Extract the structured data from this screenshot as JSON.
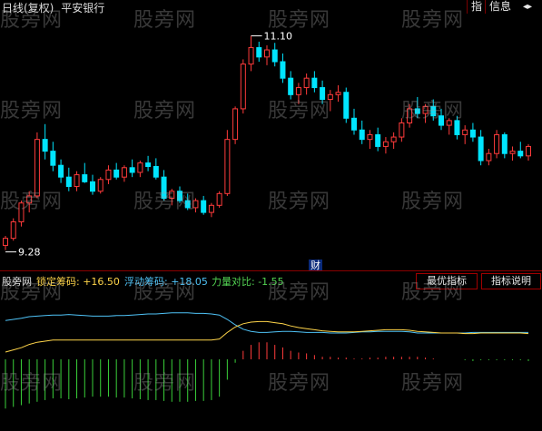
{
  "header": {
    "title": "日线(复权)",
    "stock": "平安银行",
    "btn_zhi": "指",
    "btn_info": "信息",
    "btn_close": "◂▸"
  },
  "watermark": "股旁网",
  "main_chart": {
    "high_label": "11.10",
    "low_label": "9.28",
    "cai_label": "财"
  },
  "sub_header": {
    "name": "股旁网",
    "lock": "锁定筹码: +16.50",
    "float": "浮动筹码: +18.05",
    "ratio": "力量对比: -1.55"
  },
  "tabs": {
    "best": "最优指标",
    "explain": "指标说明"
  },
  "colors": {
    "up": "#ff3b3b",
    "down": "#00e5ff",
    "lock_line": "#ffd54a",
    "float_line": "#4fc3f7",
    "pos_bar": "#ff3b3b",
    "neg_bar": "#3ad13a",
    "divider": "#8b0000"
  },
  "chart_data": {
    "type": "candlestick",
    "ohlc": [
      [
        9.32,
        9.4,
        9.28,
        9.38
      ],
      [
        9.38,
        9.55,
        9.36,
        9.52
      ],
      [
        9.52,
        9.7,
        9.48,
        9.68
      ],
      [
        9.68,
        9.78,
        9.6,
        9.74
      ],
      [
        9.74,
        10.28,
        9.72,
        10.22
      ],
      [
        10.22,
        10.35,
        10.05,
        10.12
      ],
      [
        10.12,
        10.2,
        9.95,
        10.0
      ],
      [
        10.0,
        10.05,
        9.85,
        9.9
      ],
      [
        9.9,
        9.98,
        9.78,
        9.82
      ],
      [
        9.82,
        9.95,
        9.78,
        9.92
      ],
      [
        9.92,
        10.02,
        9.85,
        9.86
      ],
      [
        9.86,
        9.92,
        9.75,
        9.78
      ],
      [
        9.78,
        9.9,
        9.76,
        9.88
      ],
      [
        9.88,
        10.0,
        9.84,
        9.96
      ],
      [
        9.96,
        10.02,
        9.88,
        9.9
      ],
      [
        9.9,
        10.0,
        9.86,
        9.98
      ],
      [
        9.98,
        10.05,
        9.9,
        9.94
      ],
      [
        9.94,
        10.04,
        9.9,
        10.02
      ],
      [
        10.02,
        10.08,
        9.95,
        9.99
      ],
      [
        9.99,
        10.06,
        9.88,
        9.9
      ],
      [
        9.9,
        9.96,
        9.7,
        9.72
      ],
      [
        9.72,
        9.8,
        9.66,
        9.78
      ],
      [
        9.78,
        9.82,
        9.68,
        9.7
      ],
      [
        9.7,
        9.76,
        9.62,
        9.64
      ],
      [
        9.64,
        9.72,
        9.6,
        9.7
      ],
      [
        9.7,
        9.74,
        9.58,
        9.6
      ],
      [
        9.6,
        9.68,
        9.56,
        9.66
      ],
      [
        9.66,
        9.78,
        9.64,
        9.76
      ],
      [
        9.76,
        10.3,
        9.74,
        10.22
      ],
      [
        10.22,
        10.5,
        10.18,
        10.48
      ],
      [
        10.48,
        10.9,
        10.44,
        10.86
      ],
      [
        10.86,
        11.1,
        10.8,
        11.0
      ],
      [
        11.0,
        11.05,
        10.88,
        10.92
      ],
      [
        10.92,
        11.02,
        10.85,
        10.98
      ],
      [
        10.98,
        11.04,
        10.84,
        10.88
      ],
      [
        10.88,
        10.95,
        10.7,
        10.74
      ],
      [
        10.74,
        10.8,
        10.56,
        10.6
      ],
      [
        10.6,
        10.7,
        10.52,
        10.66
      ],
      [
        10.66,
        10.78,
        10.6,
        10.74
      ],
      [
        10.74,
        10.8,
        10.62,
        10.66
      ],
      [
        10.66,
        10.72,
        10.52,
        10.56
      ],
      [
        10.56,
        10.64,
        10.46,
        10.6
      ],
      [
        10.6,
        10.68,
        10.54,
        10.62
      ],
      [
        10.62,
        10.66,
        10.36,
        10.4
      ],
      [
        10.4,
        10.48,
        10.26,
        10.3
      ],
      [
        10.3,
        10.38,
        10.18,
        10.22
      ],
      [
        10.22,
        10.3,
        10.14,
        10.26
      ],
      [
        10.26,
        10.32,
        10.12,
        10.16
      ],
      [
        10.16,
        10.24,
        10.1,
        10.2
      ],
      [
        10.2,
        10.28,
        10.14,
        10.24
      ],
      [
        10.24,
        10.4,
        10.2,
        10.36
      ],
      [
        10.36,
        10.52,
        10.32,
        10.48
      ],
      [
        10.48,
        10.58,
        10.4,
        10.44
      ],
      [
        10.44,
        10.52,
        10.36,
        10.5
      ],
      [
        10.5,
        10.56,
        10.38,
        10.42
      ],
      [
        10.42,
        10.48,
        10.3,
        10.34
      ],
      [
        10.34,
        10.4,
        10.26,
        10.38
      ],
      [
        10.38,
        10.42,
        10.22,
        10.26
      ],
      [
        10.26,
        10.34,
        10.18,
        10.3
      ],
      [
        10.3,
        10.36,
        10.2,
        10.24
      ],
      [
        10.24,
        10.3,
        10.0,
        10.04
      ],
      [
        10.04,
        10.14,
        10.0,
        10.1
      ],
      [
        10.1,
        10.3,
        10.06,
        10.26
      ],
      [
        10.26,
        10.28,
        10.06,
        10.1
      ],
      [
        10.1,
        10.16,
        10.04,
        10.12
      ],
      [
        10.12,
        10.2,
        10.06,
        10.08
      ],
      [
        10.08,
        10.18,
        10.04,
        10.16
      ]
    ],
    "ylim": [
      9.2,
      11.25
    ],
    "float_line": [
      0.78,
      0.8,
      0.82,
      0.85,
      0.86,
      0.87,
      0.88,
      0.88,
      0.89,
      0.88,
      0.87,
      0.86,
      0.86,
      0.86,
      0.87,
      0.87,
      0.88,
      0.89,
      0.9,
      0.9,
      0.91,
      0.92,
      0.92,
      0.92,
      0.91,
      0.91,
      0.9,
      0.88,
      0.8,
      0.7,
      0.62,
      0.58,
      0.56,
      0.56,
      0.57,
      0.58,
      0.58,
      0.57,
      0.56,
      0.56,
      0.56,
      0.55,
      0.55,
      0.55,
      0.56,
      0.57,
      0.57,
      0.58,
      0.58,
      0.58,
      0.58,
      0.57,
      0.55,
      0.55,
      0.55,
      0.55,
      0.55,
      0.55,
      0.55,
      0.56,
      0.56,
      0.56,
      0.56,
      0.56,
      0.56,
      0.56,
      0.56
    ],
    "lock_line": [
      0.2,
      0.24,
      0.28,
      0.34,
      0.38,
      0.4,
      0.42,
      0.42,
      0.42,
      0.42,
      0.42,
      0.42,
      0.42,
      0.42,
      0.42,
      0.42,
      0.42,
      0.42,
      0.42,
      0.42,
      0.42,
      0.42,
      0.42,
      0.42,
      0.42,
      0.42,
      0.42,
      0.44,
      0.56,
      0.66,
      0.72,
      0.75,
      0.76,
      0.76,
      0.74,
      0.72,
      0.68,
      0.65,
      0.63,
      0.61,
      0.59,
      0.58,
      0.57,
      0.57,
      0.57,
      0.58,
      0.59,
      0.6,
      0.61,
      0.61,
      0.61,
      0.6,
      0.58,
      0.57,
      0.56,
      0.55,
      0.55,
      0.55,
      0.54,
      0.54,
      0.55,
      0.55,
      0.55,
      0.55,
      0.55,
      0.55,
      0.54
    ],
    "ratio_bars": [
      -0.58,
      -0.56,
      -0.54,
      -0.52,
      -0.5,
      -0.48,
      -0.46,
      -0.46,
      -0.47,
      -0.46,
      -0.45,
      -0.44,
      -0.44,
      -0.44,
      -0.45,
      -0.45,
      -0.46,
      -0.47,
      -0.48,
      -0.48,
      -0.49,
      -0.5,
      -0.5,
      -0.5,
      -0.49,
      -0.49,
      -0.48,
      -0.44,
      -0.24,
      -0.04,
      0.1,
      0.17,
      0.2,
      0.2,
      0.17,
      0.14,
      0.1,
      0.08,
      0.07,
      0.05,
      0.03,
      0.03,
      0.02,
      0.02,
      0.01,
      0.01,
      0.02,
      0.02,
      0.03,
      0.03,
      0.03,
      0.03,
      0.03,
      0.02,
      0.01,
      0.0,
      0.0,
      0.0,
      -0.01,
      -0.02,
      -0.01,
      -0.01,
      -0.01,
      -0.01,
      -0.01,
      -0.01,
      -0.02
    ]
  }
}
